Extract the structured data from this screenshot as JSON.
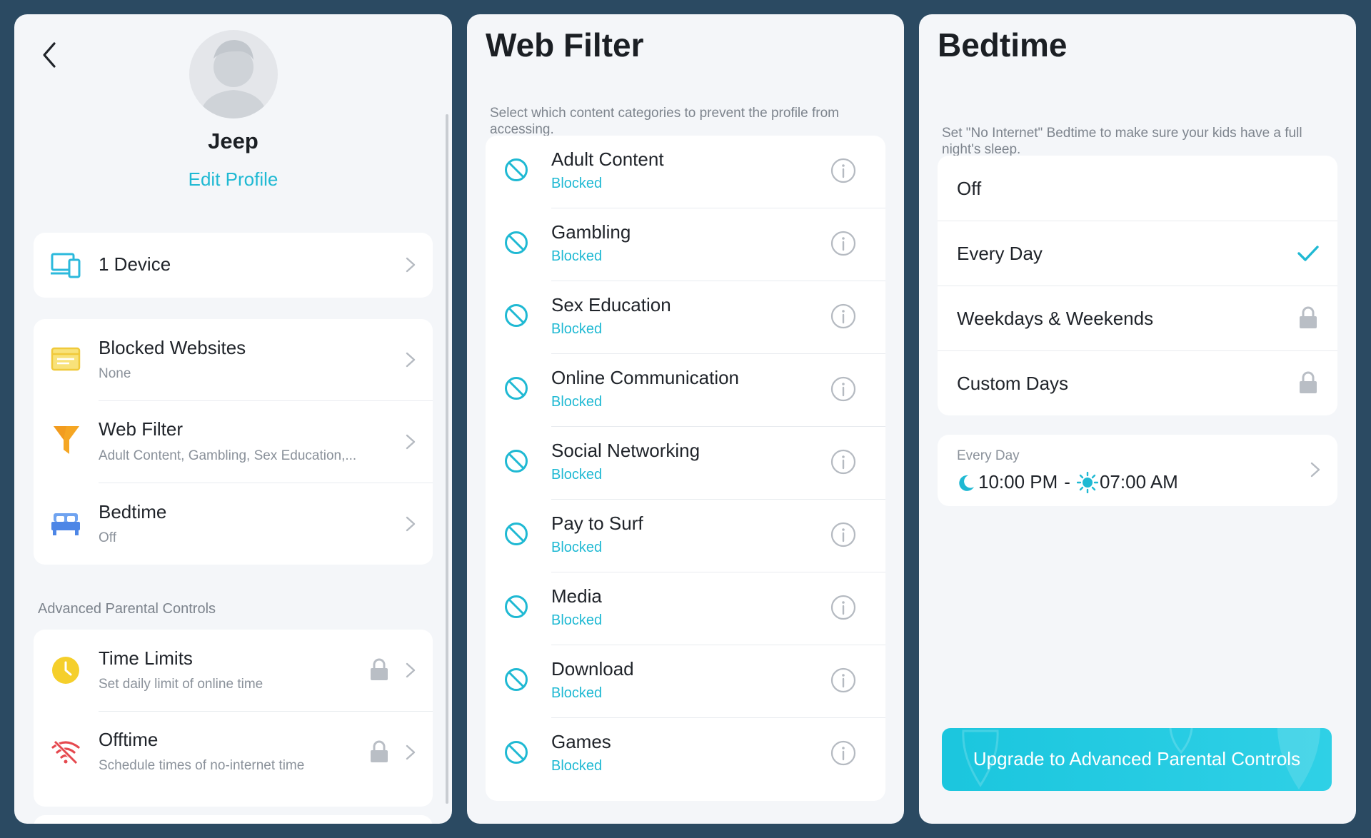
{
  "profile": {
    "name": "Jeep",
    "edit_label": "Edit Profile",
    "devices_label": "1 Device",
    "items": [
      {
        "label": "Blocked Websites",
        "sub": "None"
      },
      {
        "label": "Web Filter",
        "sub": "Adult Content, Gambling, Sex Education,..."
      },
      {
        "label": "Bedtime",
        "sub": "Off"
      }
    ],
    "advanced_title": "Advanced Parental Controls",
    "advanced": [
      {
        "label": "Time Limits",
        "sub": "Set daily limit of online time"
      },
      {
        "label": "Offtime",
        "sub": "Schedule times of no-internet time"
      }
    ]
  },
  "web_filter": {
    "title": "Web Filter",
    "description": "Select which content categories to prevent the profile from accessing.",
    "categories": [
      {
        "label": "Adult Content",
        "status": "Blocked"
      },
      {
        "label": "Gambling",
        "status": "Blocked"
      },
      {
        "label": "Sex Education",
        "status": "Blocked"
      },
      {
        "label": "Online Communication",
        "status": "Blocked"
      },
      {
        "label": "Social Networking",
        "status": "Blocked"
      },
      {
        "label": "Pay to Surf",
        "status": "Blocked"
      },
      {
        "label": "Media",
        "status": "Blocked"
      },
      {
        "label": "Download",
        "status": "Blocked"
      },
      {
        "label": "Games",
        "status": "Blocked"
      }
    ]
  },
  "bedtime": {
    "title": "Bedtime",
    "description": "Set \"No Internet\" Bedtime to make sure your kids have a full night's sleep.",
    "options": [
      {
        "label": "Off",
        "state": "none"
      },
      {
        "label": "Every Day",
        "state": "selected"
      },
      {
        "label": "Weekdays & Weekends",
        "state": "locked"
      },
      {
        "label": "Custom Days",
        "state": "locked"
      }
    ],
    "schedule": {
      "label": "Every Day",
      "start": "10:00 PM",
      "separator": "-",
      "end": "07:00 AM"
    },
    "upgrade_label": "Upgrade to Advanced Parental Controls"
  },
  "colors": {
    "accent": "#1fb9d3",
    "background": "#2b4a62",
    "panel": "#f4f6f9",
    "locked_icon": "#b9bec5",
    "offtime_icon": "#e5494f",
    "timelimit_icon": "#f5cf2b"
  }
}
